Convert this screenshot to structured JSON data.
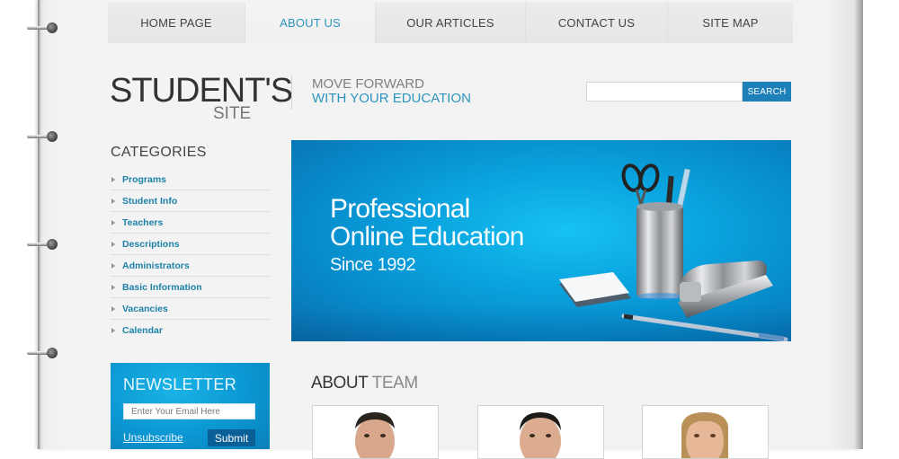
{
  "nav": {
    "items": [
      {
        "label": "HOME PAGE",
        "active": false
      },
      {
        "label": "ABOUT US",
        "active": true
      },
      {
        "label": "OUR ARTICLES",
        "active": false
      },
      {
        "label": "CONTACT US",
        "active": false
      },
      {
        "label": "SITE MAP",
        "active": false
      }
    ]
  },
  "header": {
    "logo_main": "STUDENT'S",
    "logo_sub": "SITE",
    "tagline_line1": "MOVE FORWARD",
    "tagline_line2": "WITH YOUR EDUCATION",
    "search": {
      "value": "",
      "placeholder": "",
      "button_label": "SEARCH"
    }
  },
  "sidebar": {
    "categories_title": "CATEGORIES",
    "categories": [
      "Programs",
      "Student Info",
      "Teachers",
      "Descriptions",
      "Administrators",
      "Basic Information",
      "Vacancies",
      "Calendar"
    ],
    "newsletter": {
      "title": "NEWSLETTER",
      "email_placeholder": "Enter Your Email Here",
      "email_value": "",
      "unsubscribe_label": "Unsubscribe",
      "submit_label": "Submit"
    }
  },
  "banner": {
    "line1": "Professional",
    "line2": "Online Education",
    "line3": "Since 1992",
    "image": "office-supplies-illustration"
  },
  "about_team": {
    "title_part1": "ABOUT",
    "title_part2": "TEAM",
    "members": [
      {
        "photo": "team-member-1-photo",
        "hair": "#2b2520",
        "skin": "#d9a88c"
      },
      {
        "photo": "team-member-2-photo",
        "hair": "#1e1a17",
        "skin": "#dcac90"
      },
      {
        "photo": "team-member-3-photo",
        "hair": "#b89058",
        "skin": "#e6b898"
      }
    ]
  },
  "colors": {
    "accent": "#2e95bd",
    "search_button": "#1d80b8",
    "newsletter_bg": "#0b97d2",
    "category_link": "#1e82a8"
  }
}
